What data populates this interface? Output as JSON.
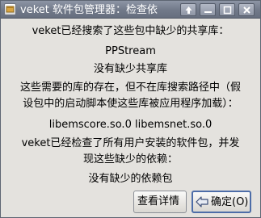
{
  "window": {
    "title": "veket 软件包管理器：检查依"
  },
  "titlebar_buttons": [
    {
      "icon": "arrow-up-icon"
    },
    {
      "icon": "minimize-icon"
    },
    {
      "icon": "maximize-icon"
    },
    {
      "icon": "close-icon"
    }
  ],
  "content": {
    "line1": "veket已经搜索了这些包中缺少的共享库：",
    "line2": "PPStream",
    "line3": "没有缺少共享库",
    "line4": "这些需要的库的存在，但不在库搜索路径中（假",
    "line5": "设包中的启动脚本使这些库被应用程序加载）：",
    "line6": "libemscore.so.0 libemsnet.so.0",
    "line7": "veket已经检查了所有用户安装的软件包，并发",
    "line8": "现这些缺少的依赖：",
    "line9": "没有缺少的依赖包"
  },
  "buttons": {
    "details_label": "查看详情",
    "ok_label": "确定(O)"
  },
  "colors": {
    "titlebar": "#757d8d",
    "background": "#e4e2de",
    "focus_border": "#4d6da8"
  }
}
